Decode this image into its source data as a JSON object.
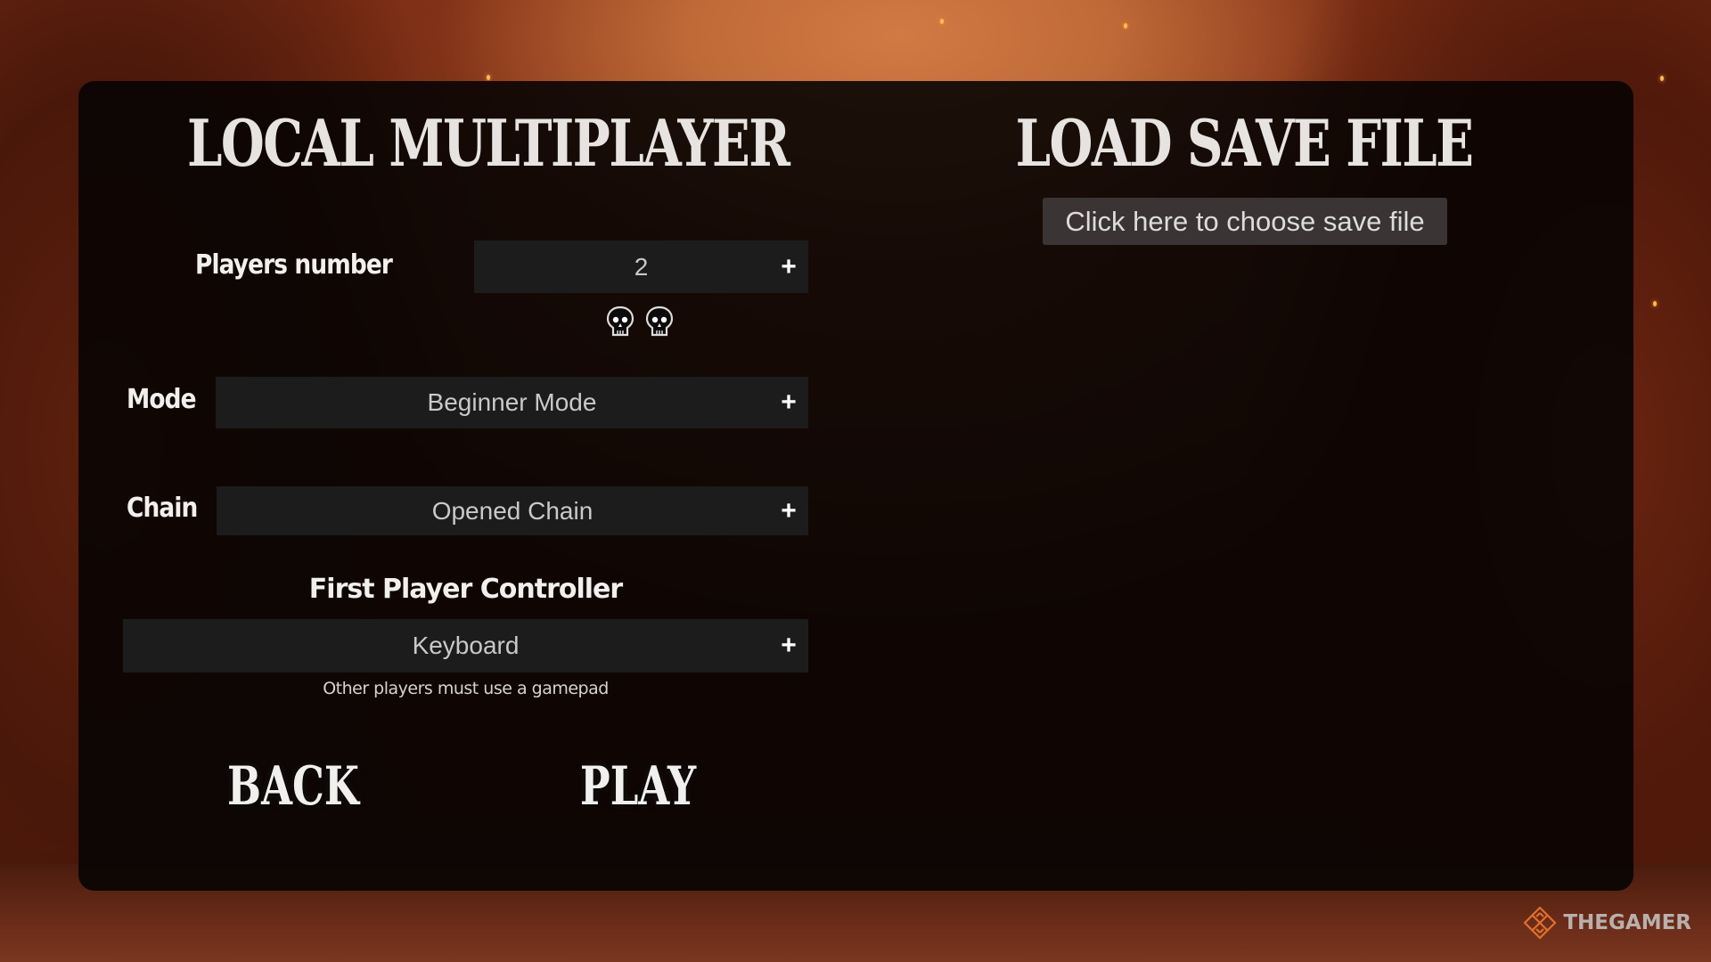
{
  "screen": {
    "title_left": "Local Multiplayer",
    "title_left_display": "LOCAL MULTIPLAYER",
    "title_right": "Load Save File",
    "title_right_display": "LOAD SAVE FILE"
  },
  "players": {
    "label": "Players number",
    "value": "2",
    "increment_icon": "+",
    "count": 2,
    "player_icon": "skull-icon"
  },
  "mode": {
    "label": "Mode",
    "value": "Beginner Mode",
    "increment_icon": "+"
  },
  "chain": {
    "label": "Chain",
    "value": "Opened Chain",
    "increment_icon": "+"
  },
  "controller": {
    "label": "First Player Controller",
    "value": "Keyboard",
    "increment_icon": "+",
    "hint": "Other players must use a gamepad"
  },
  "buttons": {
    "back": "BACK",
    "play": "PLAY"
  },
  "save_file": {
    "button_label": "Click here to choose save file"
  },
  "watermark": {
    "text": "THEGAMER"
  },
  "colors": {
    "panel_bg": "#080403",
    "field_bg": "#1c1c1c",
    "save_button_bg": "#3a3534",
    "text_primary": "#f2f0ee",
    "background_glow": "#d27a44",
    "watermark_accent": "#e0702a"
  }
}
